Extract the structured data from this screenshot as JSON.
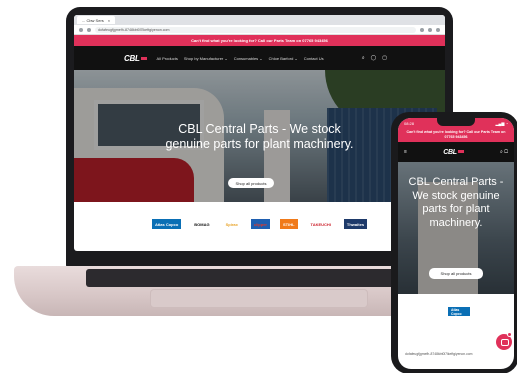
{
  "laptop": {
    "browser": {
      "tab_title": "... Cbw Sers",
      "tab_close": "×",
      "url": "dofafeugfjgmefh-8748kbt0l7lkeftgiyenon.com"
    },
    "announcement": "Can't find what you're looking for? Call our Parts Team on 07765 943456",
    "nav": {
      "logo": "CBL",
      "items": [
        "All Products",
        "Shop by Manufacturer ⌄",
        "Consumables ⌄",
        "Chloe Barford ⌄",
        "Contact Us"
      ],
      "icons": [
        "search-icon",
        "account-icon",
        "cart-icon"
      ]
    },
    "hero": {
      "title": "CBL Central Parts - We stock genuine parts for plant machinery.",
      "button": "Shop all products",
      "plate": "T828u-2"
    },
    "brands": [
      {
        "name": "Atlas Copco",
        "color": "#0a6fb5",
        "text_color": "#ffffff"
      },
      {
        "name": "BOMAG",
        "color": "#ffffff",
        "text_color": "#111111"
      },
      {
        "name": "Spirax",
        "color": "#ffffff",
        "text_color": "#e8a42a"
      },
      {
        "name": "clipper",
        "color": "#1f5fb0",
        "text_color": "#e03a2a"
      },
      {
        "name": "STIHL",
        "color": "#f07a1a",
        "text_color": "#ffffff"
      },
      {
        "name": "TAKEUCHI",
        "color": "#ffffff",
        "text_color": "#cc1f2a"
      },
      {
        "name": "Thwaites",
        "color": "#1e3a6a",
        "text_color": "#ffffff"
      }
    ]
  },
  "phone": {
    "time": "08:28",
    "back_label": "◂ Shopo",
    "announcement": "Can't find what you're looking for? Call our Parts Team on 07765 943456",
    "logo": "CBL",
    "hero_title": "CBL Central Parts - We stock genuine parts for plant machinery.",
    "button": "Shop all products",
    "brand": "Atlas Copco",
    "url": "dofafeugfjgmefh-8748kbt0l7lkeftgiyenon.com",
    "icons": [
      "menu-icon",
      "search-icon",
      "cart-icon",
      "chat-icon"
    ]
  },
  "colors": {
    "accent": "#e0315a",
    "header": "#111111"
  }
}
